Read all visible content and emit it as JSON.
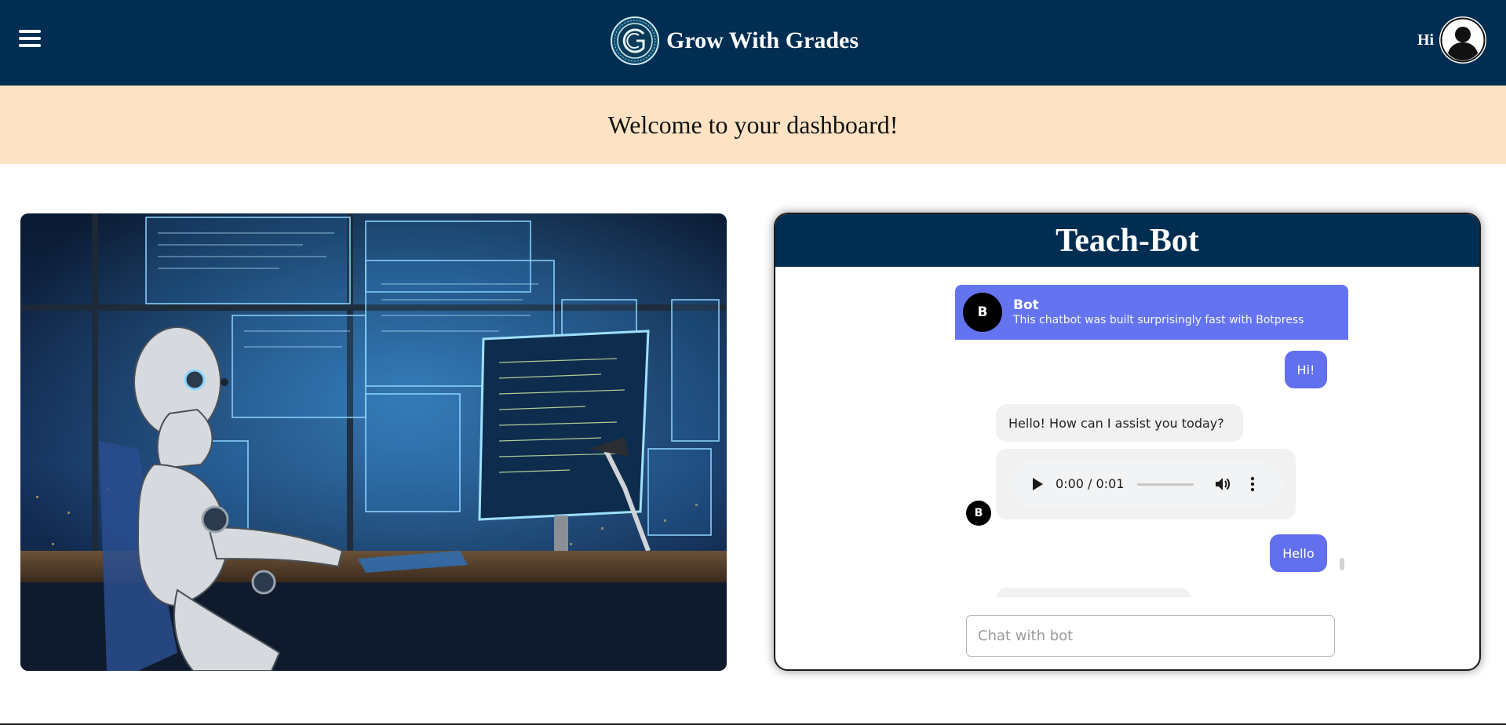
{
  "header": {
    "brand": "Grow With Grades",
    "greeting": "Hi",
    "logo_ring_text": "GROW WITH GRADES"
  },
  "banner": {
    "text": "Welcome to your dashboard!"
  },
  "teachbot": {
    "title": "Teach-Bot",
    "chat": {
      "bot_name": "Bot",
      "bot_initial": "B",
      "bot_description": "This chatbot was built surprisingly fast with Botpress",
      "messages": [
        {
          "from": "user",
          "text": "Hi!"
        },
        {
          "from": "bot",
          "text": "Hello! How can I assist you today?"
        },
        {
          "from": "bot",
          "type": "audio",
          "time": "0:00 / 0:01"
        },
        {
          "from": "user",
          "text": "Hello"
        }
      ],
      "input_placeholder": "Chat with bot"
    }
  },
  "colors": {
    "navbar": "#002d52",
    "banner": "#fde3c4",
    "chat_accent": "#6474f1",
    "user_bubble": "#6270ee",
    "bot_bubble": "#f1f1f1"
  },
  "icons": {
    "menu": "hamburger-icon",
    "profile": "user-avatar-icon",
    "play": "play-icon",
    "volume": "volume-icon",
    "more": "more-vertical-icon"
  }
}
